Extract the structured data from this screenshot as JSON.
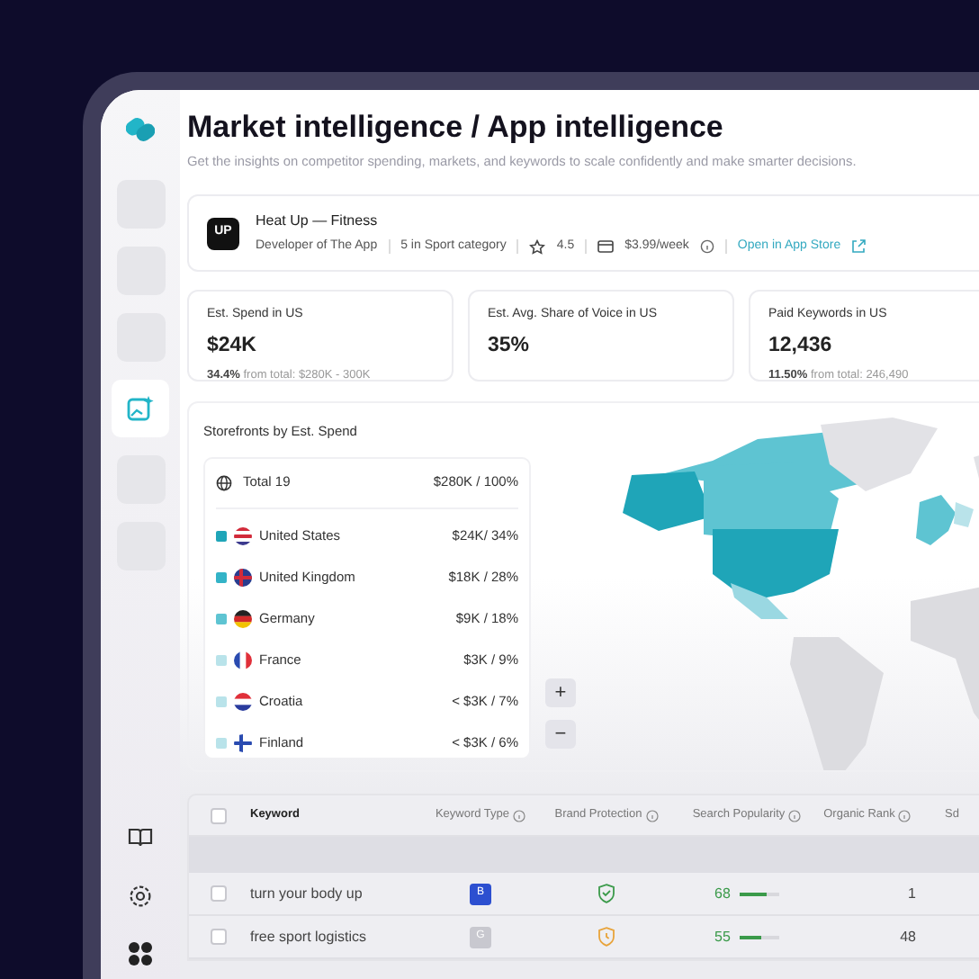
{
  "sidebar": {
    "items": [
      {
        "kind": "placeholder",
        "selected": false
      },
      {
        "kind": "placeholder",
        "selected": false
      },
      {
        "kind": "placeholder",
        "selected": false
      },
      {
        "kind": "insights",
        "selected": true
      },
      {
        "kind": "placeholder",
        "selected": false
      },
      {
        "kind": "placeholder",
        "selected": false
      }
    ],
    "bottom": [
      {
        "kind": "book"
      },
      {
        "kind": "settings"
      },
      {
        "kind": "apps"
      }
    ]
  },
  "header": {
    "title": "Market intelligence / App intelligence",
    "subtitle": "Get the insights on competitor spending, markets, and keywords to scale confidently and make smarter decisions."
  },
  "app": {
    "logo": "UP",
    "name": "Heat Up — Fitness",
    "developer": "Developer of The App",
    "category": "5 in Sport category",
    "rating": "4.5",
    "price": "$3.99/week",
    "link": "Open in App Store"
  },
  "stats": [
    {
      "label": "Est. Spend in US",
      "value": "$24K",
      "share": "34.4%",
      "note": "from total: $280K - 300K"
    },
    {
      "label": "Est. Avg. Share of Voice in US",
      "value": "35%"
    },
    {
      "label": "Paid Keywords in US",
      "value": "12,436",
      "share": "11.50%",
      "note": "from total: 246,490"
    }
  ],
  "storefronts": {
    "title": "Storefronts by Est. Spend",
    "total_label": "Total 19",
    "total_value": "$280K / 100%",
    "countries": [
      {
        "name": "United States",
        "value": "$24K/ 34%",
        "color": "#1fa5b8",
        "kind": "usa"
      },
      {
        "name": "United Kingdom",
        "value": "$18K / 28%",
        "color": "#33b3c7",
        "kind": "uk"
      },
      {
        "name": "Germany",
        "value": "$9K / 18%",
        "color": "#5ec4d2",
        "kind": "germany"
      },
      {
        "name": "France",
        "value": "$3K  / 9%",
        "color": "#b9e3ea",
        "kind": "france"
      },
      {
        "name": "Croatia",
        "value": "< $3K / 7%",
        "color": "#b9e3ea",
        "kind": "croatia"
      },
      {
        "name": "Finland",
        "value": "< $3K / 6%",
        "color": "#b9e3ea",
        "kind": "finland"
      }
    ],
    "zoom_in": "+",
    "zoom_out": "−"
  },
  "table": {
    "select_all_checked": false,
    "columns": [
      "Keyword",
      "Keyword Type",
      "Brand Protection",
      "Search Popularity",
      "Organic Rank",
      "Sd"
    ],
    "rows": [
      {
        "checked": false,
        "keyword": "turn your body up",
        "type": "B",
        "color": "#2c4fd0",
        "kind": "protected",
        "popularity": "68",
        "level": 0.68,
        "rank": "1"
      },
      {
        "checked": false,
        "keyword": "free sport logistics",
        "type": "G",
        "color": "#c8c8cf",
        "kind": "warning",
        "popularity": "55",
        "level": 0.55,
        "rank": "48"
      }
    ]
  }
}
